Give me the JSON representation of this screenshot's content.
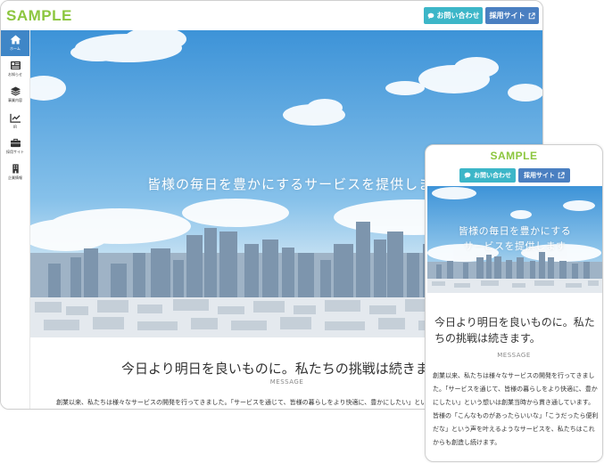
{
  "brand": {
    "logo": "SAMPLE",
    "accent": "#8cc63f"
  },
  "header": {
    "contact_label": "お問い合わせ",
    "recruit_label": "採用サイト",
    "contact_color": "#3cb6c8",
    "recruit_color": "#4a7fc1"
  },
  "sidebar": {
    "active_color": "#3f86c7",
    "items": [
      {
        "label": "ホーム",
        "icon": "home-icon",
        "active": true
      },
      {
        "label": "お知らせ",
        "icon": "news-icon",
        "active": false
      },
      {
        "label": "事業内容",
        "icon": "layers-icon",
        "active": false
      },
      {
        "label": "IR",
        "icon": "chart-icon",
        "active": false
      },
      {
        "label": "採用サイト",
        "icon": "briefcase-icon",
        "active": false
      },
      {
        "label": "企業情報",
        "icon": "building-icon",
        "active": false
      }
    ]
  },
  "hero": {
    "text": "皆様の毎日を豊かにするサービスを提供します",
    "mobile_line1": "皆様の毎日を豊かにする",
    "mobile_line2": "サービスを提供します"
  },
  "message": {
    "title": "今日より明日を良いものに。私たちの挑戦は続きます。",
    "subtitle": "MESSAGE",
    "body": "創業以来、私たちは様々なサービスの開発を行ってきました。「サービスを通じて、皆様の暮らしをより快適に、豊かにしたい」という想いは創業当時から貫き通しています。皆様の「こんなものがあったらいいな」「こうだったら便利だな」という声を叶えるようなサービスを、私たちはこれからも創造し続けます。"
  }
}
